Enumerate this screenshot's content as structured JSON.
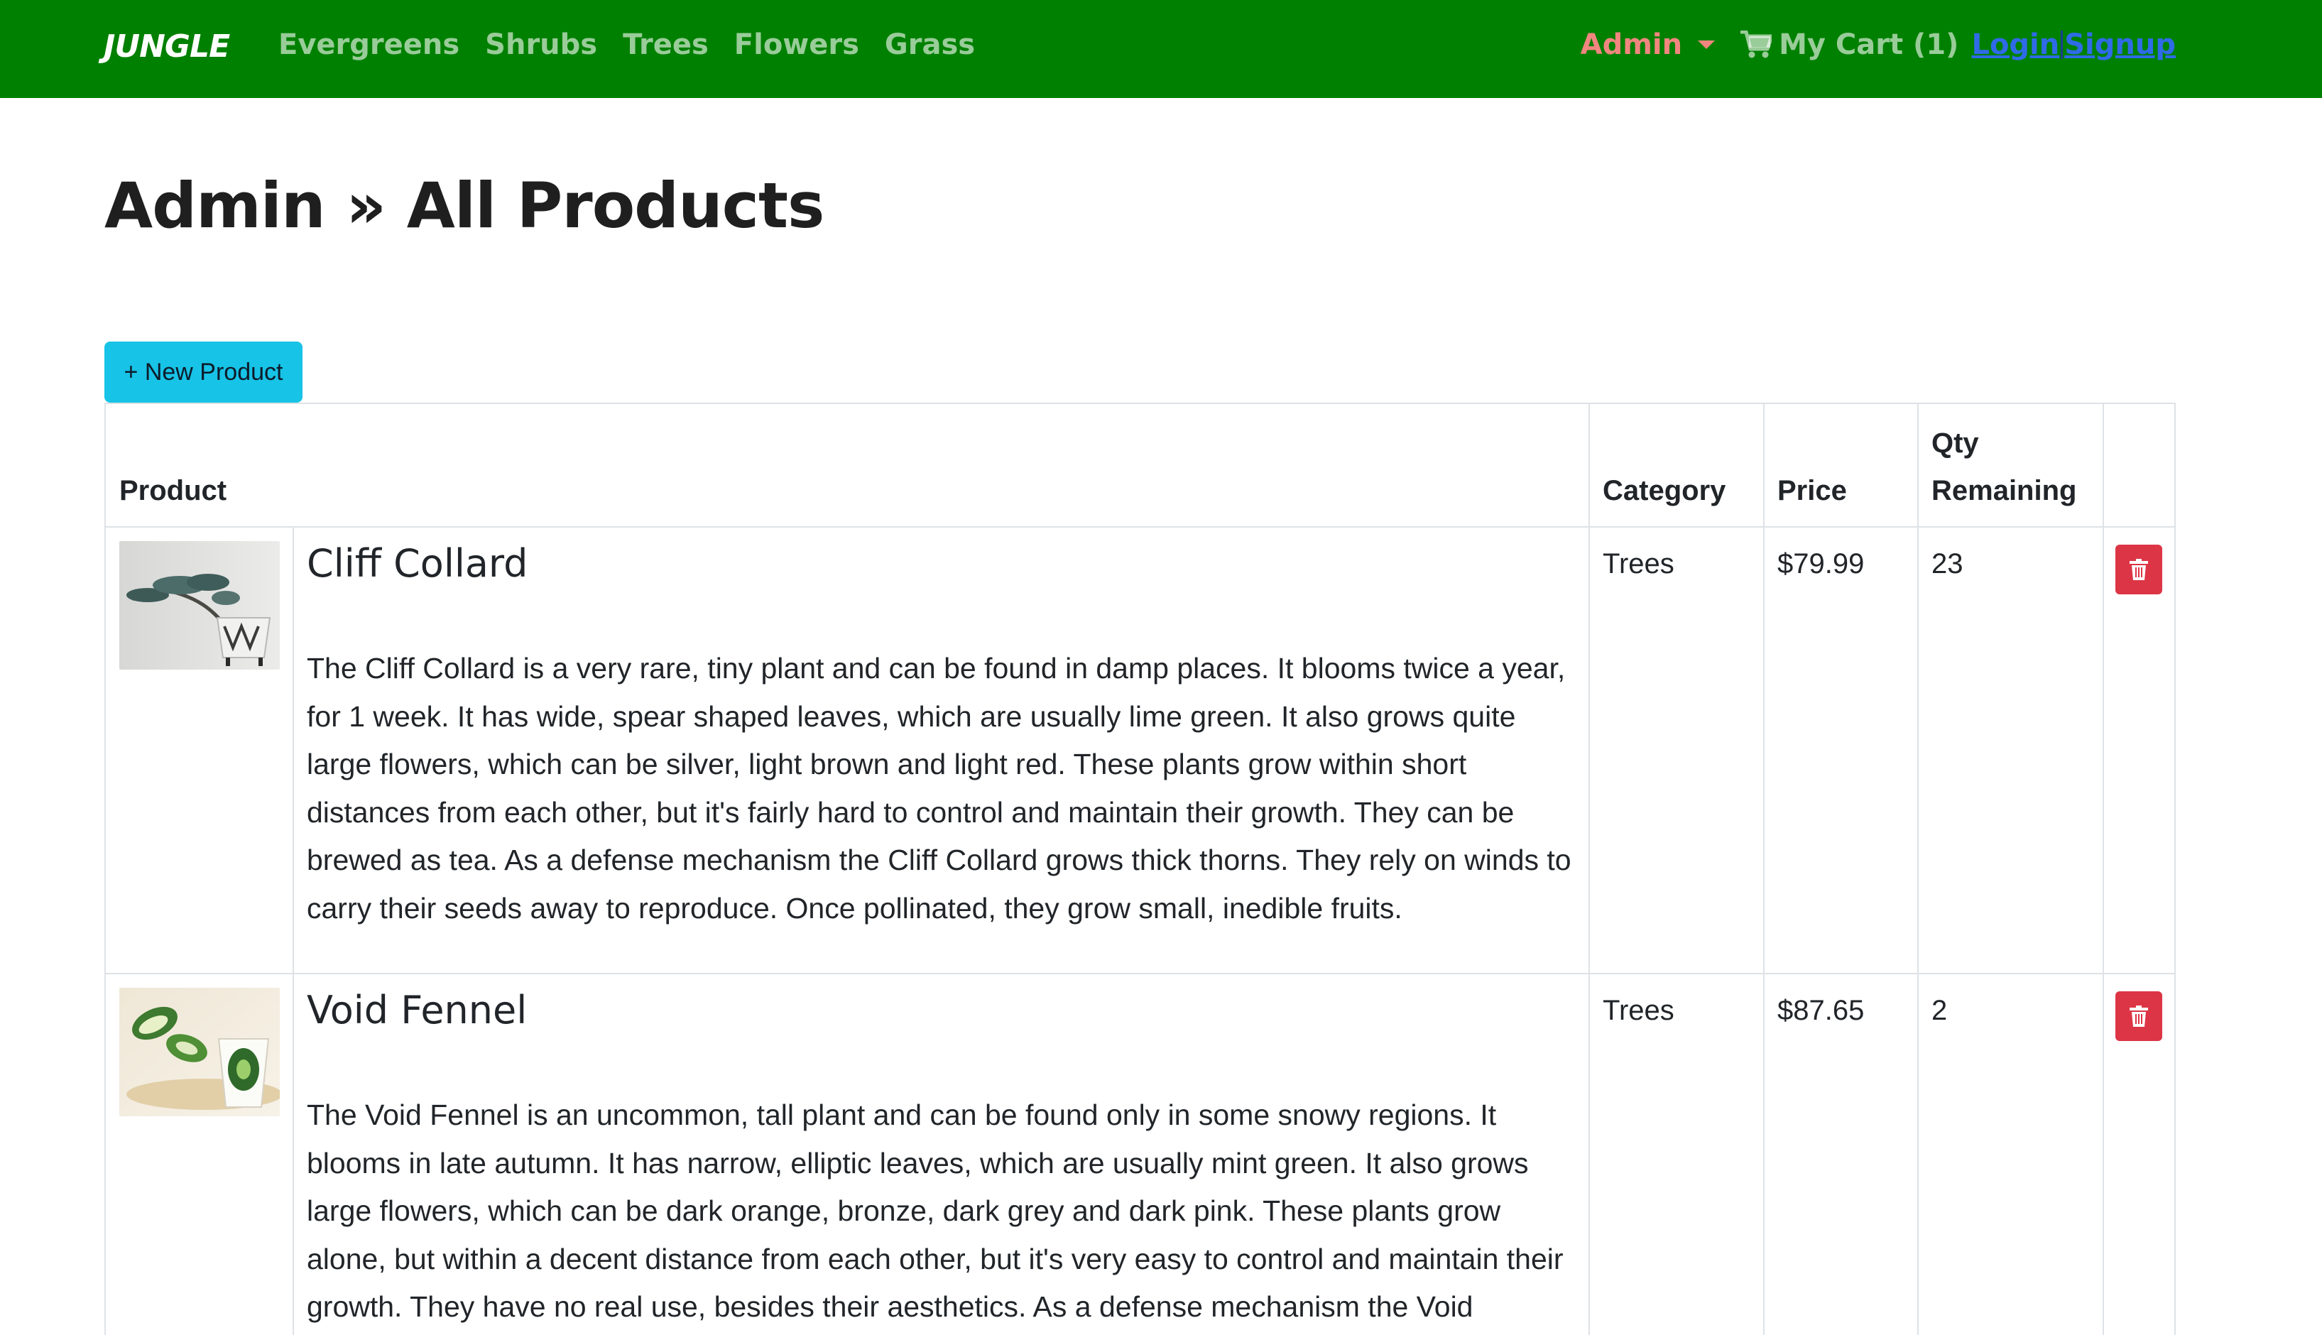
{
  "nav": {
    "brand": "JUNGLE",
    "links": [
      "Evergreens",
      "Shrubs",
      "Trees",
      "Flowers",
      "Grass"
    ],
    "admin_label": "Admin",
    "cart_label": "My Cart (1)",
    "login_label": "Login",
    "signup_label": "Signup"
  },
  "page": {
    "title": "Admin » All Products",
    "new_button": "+ New Product"
  },
  "table": {
    "headers": {
      "product": "Product",
      "category": "Category",
      "price": "Price",
      "qty_line1": "Qty",
      "qty_line2": "Remaining"
    },
    "rows": [
      {
        "name": "Cliff Collard",
        "description": "The Cliff Collard is a very rare, tiny plant and can be found in damp places. It blooms twice a year, for 1 week. It has wide, spear shaped leaves, which are usually lime green. It also grows quite large flowers, which can be silver, light brown and light red. These plants grow within short distances from each other, but it's fairly hard to control and maintain their growth. They can be brewed as tea. As a defense mechanism the Cliff Collard grows thick thorns. They rely on winds to carry their seeds away to reproduce. Once pollinated, they grow small, inedible fruits.",
        "category": "Trees",
        "price": "$79.99",
        "qty": "23"
      },
      {
        "name": "Void Fennel",
        "description": "The Void Fennel is an uncommon, tall plant and can be found only in some snowy regions. It blooms in late autumn. It has narrow, elliptic leaves, which are usually mint green. It also grows large flowers, which can be dark orange, bronze, dark grey and dark pink. These plants grow alone, but within a decent distance from each other, but it's very easy to control and maintain their growth. They have no real use, besides their aesthetics. As a defense mechanism the Void",
        "category": "Trees",
        "price": "$87.65",
        "qty": "2"
      }
    ]
  },
  "colors": {
    "navbar_bg": "#008000",
    "admin_link": "#f0867f",
    "auth_link": "#2f6be6",
    "new_button_bg": "#17c3e6",
    "delete_button_bg": "#dc3545"
  }
}
